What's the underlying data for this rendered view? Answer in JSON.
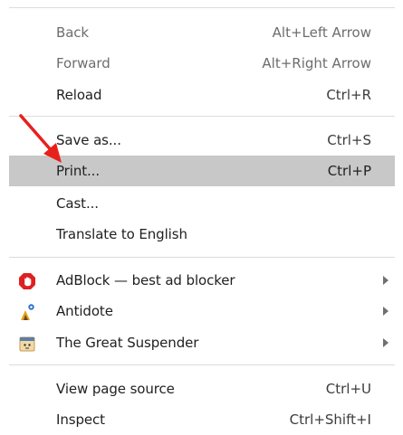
{
  "menu": {
    "items": [
      {
        "label": "Back",
        "shortcut": "Alt+Left Arrow"
      },
      {
        "label": "Forward",
        "shortcut": "Alt+Right Arrow"
      },
      {
        "label": "Reload",
        "shortcut": "Ctrl+R"
      },
      {
        "label": "Save as...",
        "shortcut": "Ctrl+S"
      },
      {
        "label": "Print...",
        "shortcut": "Ctrl+P"
      },
      {
        "label": "Cast..."
      },
      {
        "label": "Translate to English"
      },
      {
        "label": "AdBlock — best ad blocker",
        "icon": "adblock-icon"
      },
      {
        "label": "Antidote",
        "icon": "antidote-icon"
      },
      {
        "label": "The Great Suspender",
        "icon": "great-suspender-icon"
      },
      {
        "label": "View page source",
        "shortcut": "Ctrl+U"
      },
      {
        "label": "Inspect",
        "shortcut": "Ctrl+Shift+I"
      }
    ]
  },
  "colors": {
    "highlight": "#c8c8c8",
    "annotation_arrow": "#e8201c",
    "adblock_red": "#e02020",
    "separator": "#dcdcdc"
  }
}
